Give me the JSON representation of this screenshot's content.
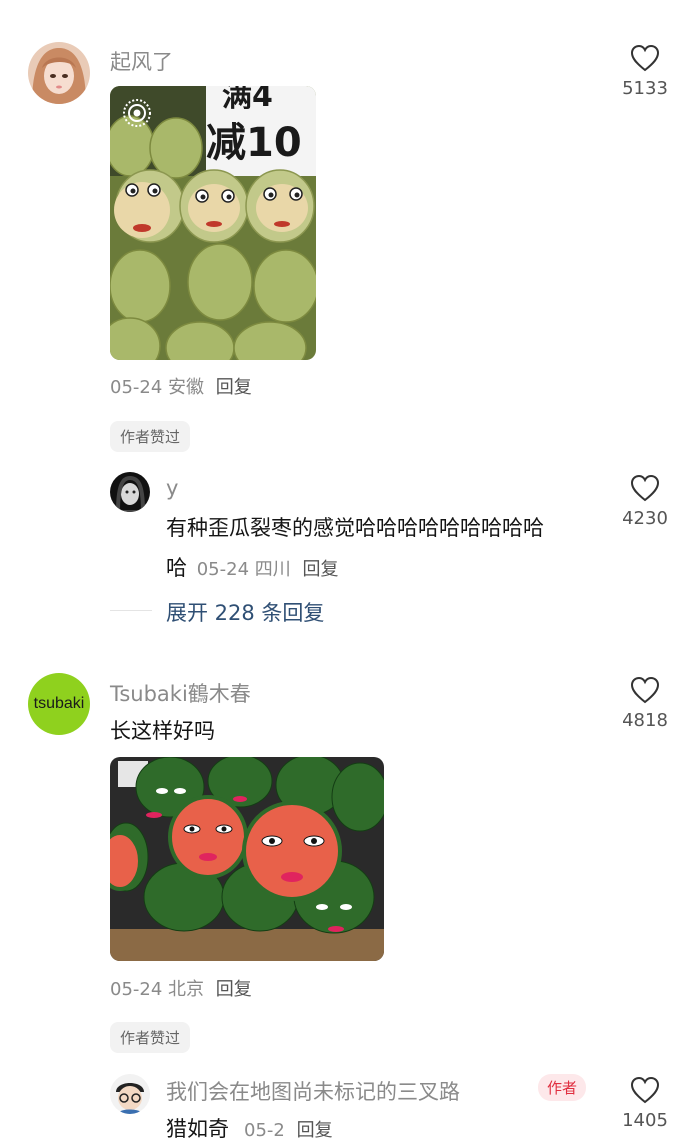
{
  "comments": [
    {
      "username": "起风了",
      "likes": "5133",
      "meta_date": "05-24",
      "meta_location": "安徽",
      "reply_label": "回复",
      "badge": "作者赞过",
      "image_icon": "live-photo-icon",
      "image_text_1": "满4",
      "image_text_2": "减10"
    },
    {
      "username": "Tsubaki鶴木春",
      "avatar_text": "tsubaki",
      "text": "长这样好吗",
      "likes": "4818",
      "meta_date": "05-24",
      "meta_location": "北京",
      "reply_label": "回复",
      "badge": "作者赞过"
    }
  ],
  "replies": [
    {
      "username": "y",
      "text_line1": "有种歪瓜裂枣的感觉哈哈哈哈哈哈哈哈哈",
      "text_line2": "哈",
      "likes": "4230",
      "meta_date": "05-24",
      "meta_location": "四川",
      "reply_label": "回复"
    },
    {
      "username": "我们会在地图尚未标记的三叉路",
      "author_tag": "作者",
      "text": "猎如奇",
      "likes": "1405",
      "meta_date": "05-2",
      "reply_label": "回复"
    }
  ],
  "expand_replies": "展开 228 条回复",
  "colors": {
    "username_gray": "#8a8a8a",
    "link_blue": "#2f4f74",
    "author_tag_red": "#e02e3f",
    "tsubaki_green": "#8fd11e"
  }
}
